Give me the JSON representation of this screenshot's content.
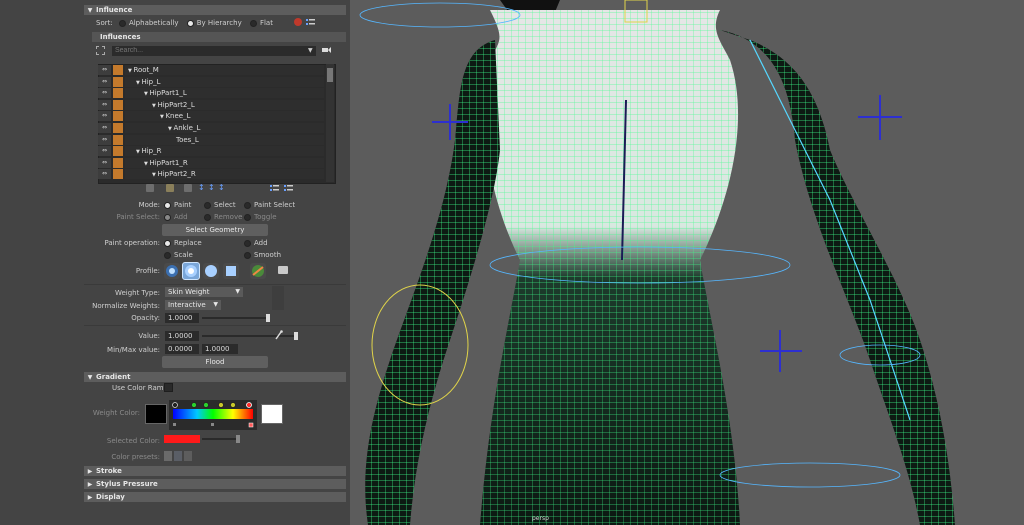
{
  "influence_section": {
    "title": "Influence"
  },
  "sort": {
    "label": "Sort:",
    "options": [
      "Alphabetically",
      "By Hierarchy",
      "Flat"
    ],
    "selected": "By Hierarchy"
  },
  "influences_section": {
    "title": "Influences"
  },
  "search": {
    "placeholder": "Search..."
  },
  "joints": [
    {
      "name": "Root_M",
      "depth": 0
    },
    {
      "name": "Hip_L",
      "depth": 1
    },
    {
      "name": "HipPart1_L",
      "depth": 2
    },
    {
      "name": "HipPart2_L",
      "depth": 3
    },
    {
      "name": "Knee_L",
      "depth": 4
    },
    {
      "name": "Ankle_L",
      "depth": 5
    },
    {
      "name": "Toes_L",
      "depth": 6
    },
    {
      "name": "Hip_R",
      "depth": 1
    },
    {
      "name": "HipPart1_R",
      "depth": 2
    },
    {
      "name": "HipPart2_R",
      "depth": 3
    }
  ],
  "mode": {
    "label": "Mode:",
    "options": [
      "Paint",
      "Select",
      "Paint Select"
    ],
    "selected": "Paint"
  },
  "paint_select": {
    "label": "Paint Select:",
    "options": [
      "Add",
      "Remove",
      "Toggle"
    ]
  },
  "select_geometry_button": "Select Geometry",
  "paint_operation": {
    "label": "Paint operation:",
    "options": [
      "Replace",
      "Add",
      "Scale",
      "Smooth"
    ],
    "selected": "Replace"
  },
  "profile": {
    "label": "Profile:"
  },
  "weight_type": {
    "label": "Weight Type:",
    "value": "Skin Weight"
  },
  "normalize_weights": {
    "label": "Normalize Weights:",
    "value": "Interactive"
  },
  "opacity": {
    "label": "Opacity:",
    "value": "1.0000",
    "fraction": 1.0
  },
  "value": {
    "label": "Value:",
    "value": "1.0000",
    "fraction": 1.0
  },
  "min_max": {
    "label": "Min/Max value:",
    "min": "0.0000",
    "max": "1.0000"
  },
  "flood_button": "Flood",
  "gradient_section": {
    "title": "Gradient"
  },
  "use_color_ramp": {
    "label": "Use Color Ramp"
  },
  "weight_color": {
    "label": "Weight Color:"
  },
  "selected_color": {
    "label": "Selected Color:",
    "color": "#ff1a1a"
  },
  "color_presets": {
    "label": "Color presets:"
  },
  "stroke_section": {
    "title": "Stroke"
  },
  "stylus_section": {
    "title": "Stylus Pressure"
  },
  "display_section": {
    "title": "Display"
  },
  "colors": {
    "panel_bg": "#444444",
    "section_header": "#5d5d5d",
    "joint_lock": "#c47a2c",
    "viewport_bg": "#5c5c5c",
    "mesh_wire": "#3dff8a",
    "skin_weight_white": "#e6e6e6",
    "locator_blue": "#2d2fd0"
  }
}
